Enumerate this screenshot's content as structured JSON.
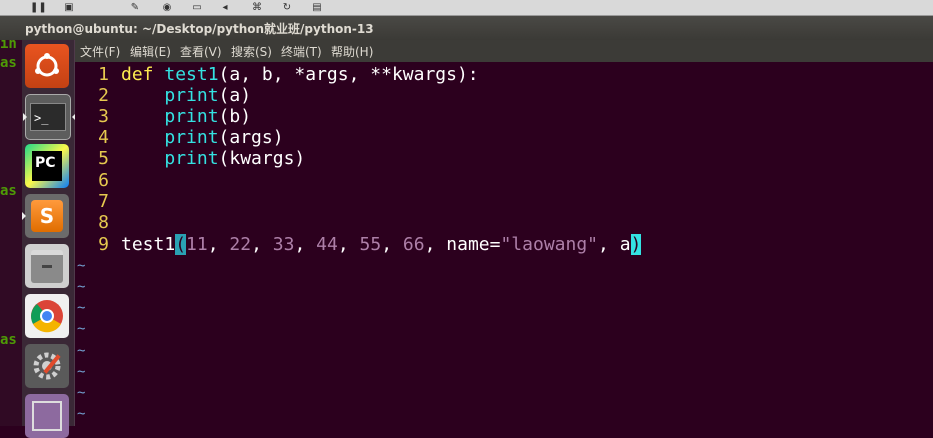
{
  "window": {
    "title": "python@ubuntu: ~/Desktop/python就业班/python-13"
  },
  "menu": [
    "文件(F)",
    "编辑(E)",
    "查看(V)",
    "搜索(S)",
    "终端(T)",
    "帮助(H)"
  ],
  "background_terminal": {
    "fragments": [
      "in",
      "as",
      "as",
      "as"
    ]
  },
  "launcher": {
    "items": [
      "ubuntu-logo-icon",
      "terminal-icon",
      "pycharm-icon",
      "sublime-text-icon",
      "files-icon",
      "chrome-icon",
      "settings-icon",
      "workspace-icon"
    ],
    "pycharm_label": "PC",
    "terminal_label": ">_",
    "sublime_label": "S"
  },
  "editor": {
    "line_numbers": [
      "1",
      "2",
      "3",
      "4",
      "5",
      "6",
      "7",
      "8",
      "9"
    ],
    "line1": {
      "kw": "def",
      "fn": "test1",
      "rest": "(a, b, *args, **kwargs):"
    },
    "line2": {
      "indent": "    ",
      "fn": "print",
      "rest": "(a)"
    },
    "line3": {
      "indent": "    ",
      "fn": "print",
      "rest": "(b)"
    },
    "line4": {
      "indent": "    ",
      "fn": "print",
      "rest": "(args)"
    },
    "line5": {
      "indent": "    ",
      "fn": "print",
      "rest": "(kwargs)"
    },
    "line9": {
      "call": "test1",
      "open": "(",
      "n1": "11",
      "c1": ", ",
      "n2": "22",
      "c2": ", ",
      "n3": "33",
      "c3": ", ",
      "n4": "44",
      "c4": ", ",
      "n5": "55",
      "c5": ", ",
      "n6": "66",
      "c6": ", ",
      "kwarg": "name=",
      "strval": "\"laowang\"",
      "c7": ", ",
      "arg": "a",
      "close": ")"
    },
    "tilde": "~"
  },
  "colors": {
    "background": "#2c001e",
    "line_number": "#e6c94f",
    "keyword": "#fce94f",
    "function": "#34e2e2",
    "literal": "#ad7fa8",
    "tilde": "#729fcf"
  }
}
